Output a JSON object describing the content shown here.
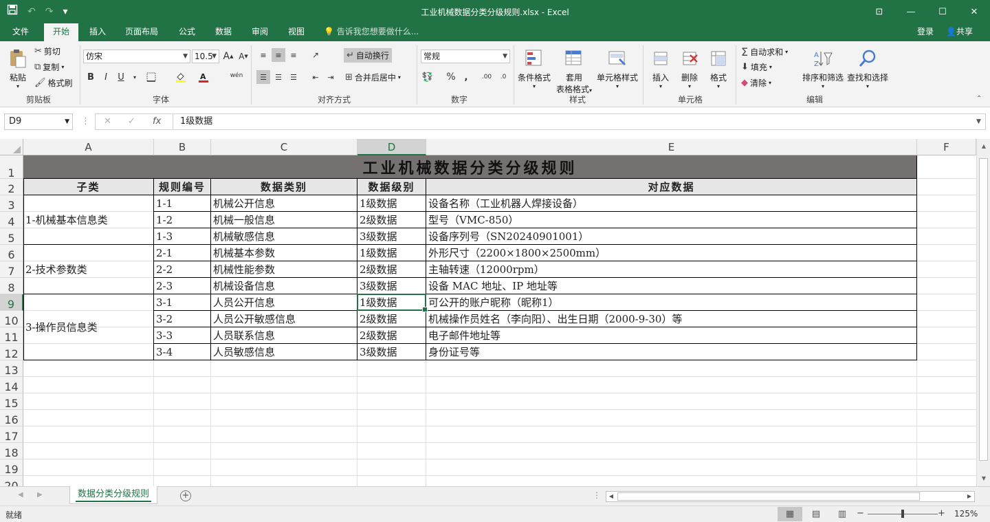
{
  "window": {
    "title": "工业机械数据分类分级规则.xlsx - Excel",
    "qat": {
      "save_icon": "save-icon",
      "undo": "↶",
      "redo": "↷",
      "customize": "▾"
    },
    "controls": {
      "ribbon_display": "⊡",
      "minimize": "—",
      "maximize": "☐",
      "close": "✕"
    }
  },
  "tabs": {
    "items": [
      "文件",
      "开始",
      "插入",
      "页面布局",
      "公式",
      "数据",
      "审阅",
      "视图"
    ],
    "active": "开始",
    "tell_me": "告诉我您想要做什么...",
    "login": "登录",
    "share": "共享"
  },
  "ribbon": {
    "clipboard": {
      "label": "剪贴板",
      "paste": "粘贴",
      "cut": "剪切",
      "copy": "复制",
      "format_painter": "格式刷"
    },
    "font": {
      "label": "字体",
      "name": "仿宋",
      "size": "10.5",
      "bold": "B",
      "italic": "I",
      "underline": "U",
      "grow": "A",
      "shrink": "A",
      "wen": "wén"
    },
    "alignment": {
      "label": "对齐方式",
      "wrap_text": "自动换行",
      "merge_center": "合并后居中"
    },
    "number": {
      "label": "数字",
      "format": "常规",
      "percent": "%",
      "comma": ","
    },
    "styles": {
      "label": "样式",
      "conditional": "条件格式",
      "table_line1": "套用",
      "table_line2": "表格格式",
      "cell_styles": "单元格样式"
    },
    "cells": {
      "label": "单元格",
      "insert": "插入",
      "delete": "删除",
      "format": "格式"
    },
    "editing": {
      "label": "编辑",
      "autosum": "自动求和",
      "fill": "填充",
      "clear": "清除",
      "sort_filter": "排序和筛选",
      "find_select": "查找和选择"
    }
  },
  "formula_bar": {
    "name_box": "D9",
    "cancel": "✕",
    "enter": "✓",
    "fx": "fx",
    "content": "1级数据"
  },
  "columns": [
    "A",
    "B",
    "C",
    "D",
    "E",
    "F"
  ],
  "selected_column": "D",
  "rows": [
    "1",
    "2",
    "3",
    "4",
    "5",
    "6",
    "7",
    "8",
    "9",
    "10",
    "11",
    "12",
    "13",
    "14",
    "15",
    "16",
    "17",
    "18",
    "19",
    "20"
  ],
  "selected_row": "9",
  "sheet": {
    "title": "工业机械数据分类分级规则",
    "headers": [
      "子类",
      "规则编号",
      "数据类别",
      "数据级别",
      "对应数据"
    ],
    "groups": [
      {
        "subclass": "1-机械基本信息类",
        "rows": [
          {
            "id": "1-1",
            "category": "机械公开信息",
            "level": "1级数据",
            "data": "设备名称（工业机器人焊接设备）"
          },
          {
            "id": "1-2",
            "category": "机械一般信息",
            "level": "2级数据",
            "data": "型号（VMC-850）"
          },
          {
            "id": "1-3",
            "category": "机械敏感信息",
            "level": "3级数据",
            "data": "设备序列号（SN20240901001）"
          }
        ]
      },
      {
        "subclass": "2-技术参数类",
        "rows": [
          {
            "id": "2-1",
            "category": "机械基本参数",
            "level": "1级数据",
            "data": "外形尺寸（2200×1800×2500mm）"
          },
          {
            "id": "2-2",
            "category": "机械性能参数",
            "level": "2级数据",
            "data": "主轴转速（12000rpm）"
          },
          {
            "id": "2-3",
            "category": "机械设备信息",
            "level": "3级数据",
            "data": "设备 MAC 地址、IP 地址等"
          }
        ]
      },
      {
        "subclass": "3-操作员信息类",
        "rows": [
          {
            "id": "3-1",
            "category": "人员公开信息",
            "level": "1级数据",
            "data": "可公开的账户昵称（昵称1）"
          },
          {
            "id": "3-2",
            "category": "人员公开敏感信息",
            "level": "2级数据",
            "data": "机械操作员姓名（李向阳）、出生日期（2000-9-30）等"
          },
          {
            "id": "3-3",
            "category": "人员联系信息",
            "level": "2级数据",
            "data": "电子邮件地址等"
          },
          {
            "id": "3-4",
            "category": "人员敏感信息",
            "level": "3级数据",
            "data": "身份证号等"
          }
        ]
      }
    ]
  },
  "sheet_tabs": {
    "active": "数据分类分级规则",
    "add": "+"
  },
  "status": {
    "ready": "就绪",
    "zoom": "125%",
    "zoom_minus": "−",
    "zoom_plus": "+"
  },
  "colors": {
    "accent": "#217346",
    "title_fill": "#767171",
    "header_fill": "#e7e6e6"
  }
}
